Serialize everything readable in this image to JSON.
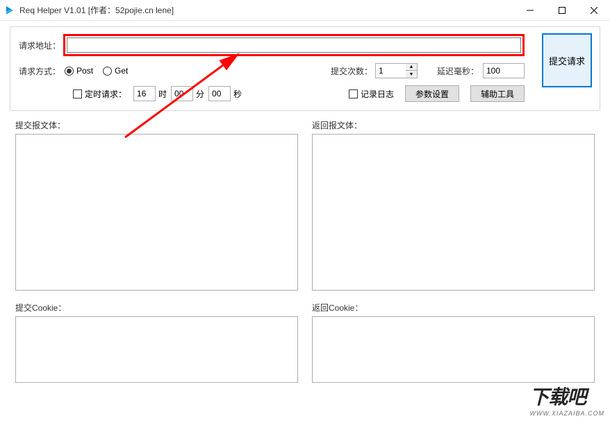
{
  "window": {
    "title": "Req Helper V1.01    [作者：52pojie.cn lene]"
  },
  "labels": {
    "url": "请求地址：",
    "method": "请求方式：",
    "post": "Post",
    "get": "Get",
    "submit_count": "提交次数：",
    "delay_ms": "延迟毫秒：",
    "timed_request": "定时请求：",
    "hour": "时",
    "minute": "分",
    "second": "秒",
    "log": "记录日志",
    "param_settings": "参数设置",
    "helper_tools": "辅助工具",
    "submit_request": "提交请求",
    "request_body": "提交报文体：",
    "response_body": "返回报文体：",
    "request_cookie": "提交Cookie：",
    "response_cookie": "返回Cookie："
  },
  "values": {
    "url": "",
    "submit_count": "1",
    "delay_ms": "100",
    "hour": "16",
    "minute": "00",
    "second": "00"
  },
  "watermark": {
    "main": "下载吧",
    "sub": "WWW.XIAZAIBA.COM"
  }
}
